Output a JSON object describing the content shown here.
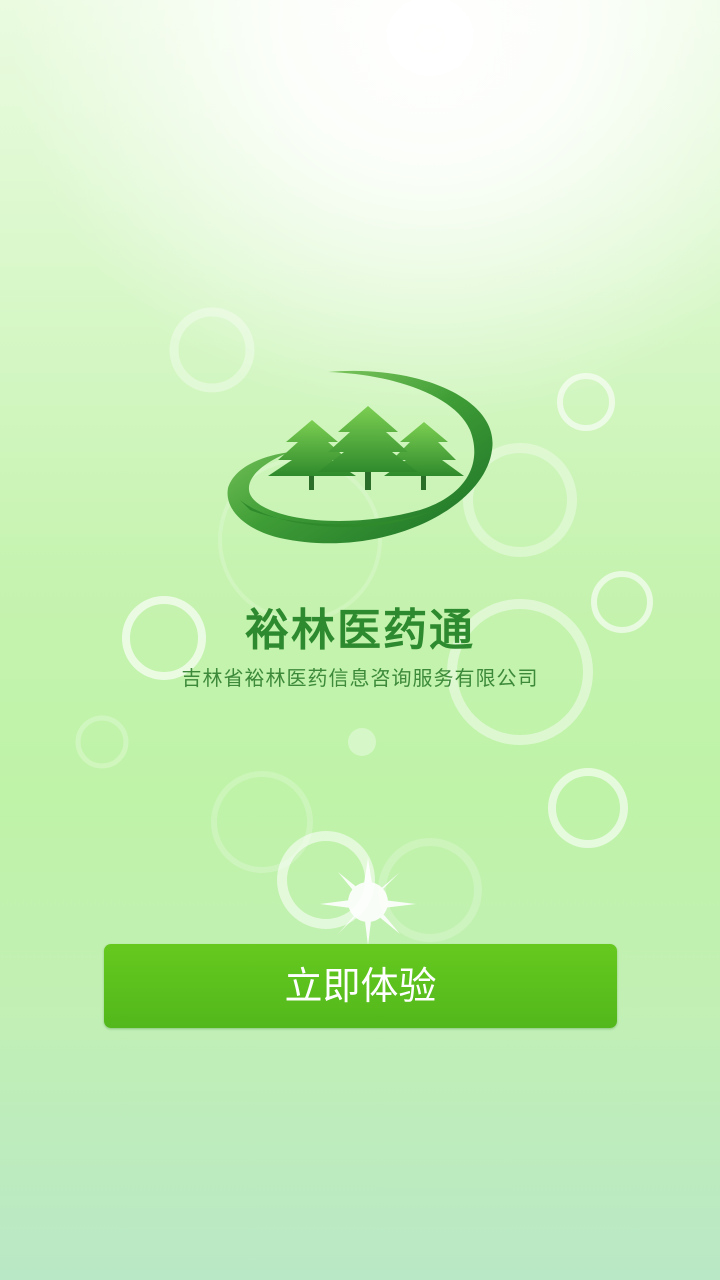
{
  "splash": {
    "app_name": "裕林医药通",
    "company_name": "吉林省裕林医药信息咨询服务有限公司",
    "start_button_label": "立即体验",
    "logo_icon": "pine-trees-logo-icon"
  },
  "colors": {
    "brand_green": "#2e8a2e",
    "button_green": "#5cc01d",
    "logo_dark_green": "#1f7a2a",
    "logo_light_green": "#6cc04a"
  }
}
